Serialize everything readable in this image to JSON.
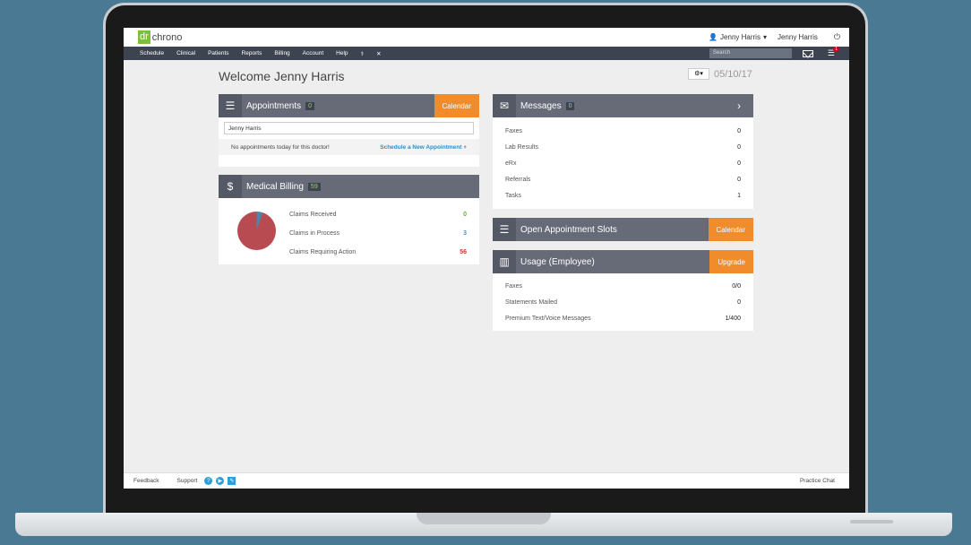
{
  "app": {
    "logo_dr": "dr",
    "logo_name": "chrono"
  },
  "topbar": {
    "user_menu": "Jenny Harris",
    "user_name": "Jenny Harris",
    "power_icon": "power-icon"
  },
  "nav": {
    "items": [
      "Schedule",
      "Clinical",
      "Patients",
      "Reports",
      "Billing",
      "Account",
      "Help"
    ],
    "search_placeholder": "Search",
    "notification_count": "1"
  },
  "page": {
    "welcome": "Welcome Jenny Harris",
    "date": "05/10/17",
    "gear_label": "⚙▾"
  },
  "appointments": {
    "title": "Appointments",
    "count": "0",
    "button": "Calendar",
    "doctor": "Jenny Harris",
    "empty_text": "No appointments today for this doctor!",
    "schedule_link": "Schedule a New Appointment +"
  },
  "billing": {
    "title": "Medical Billing",
    "count": "59",
    "claims": [
      {
        "label": "Claims Received",
        "value": "0"
      },
      {
        "label": "Claims in Process",
        "value": "3"
      },
      {
        "label": "Claims Requiring Action",
        "value": "56"
      }
    ]
  },
  "messages": {
    "title": "Messages",
    "count": "0",
    "rows": [
      {
        "label": "Faxes",
        "value": "0"
      },
      {
        "label": "Lab Results",
        "value": "0"
      },
      {
        "label": "eRx",
        "value": "0"
      },
      {
        "label": "Referrals",
        "value": "0"
      },
      {
        "label": "Tasks",
        "value": "1"
      }
    ]
  },
  "open_slots": {
    "title": "Open Appointment Slots",
    "button": "Calendar"
  },
  "usage": {
    "title": "Usage (Employee)",
    "button": "Upgrade",
    "rows": [
      {
        "label": "Faxes",
        "value": "0/0"
      },
      {
        "label": "Statements Mailed",
        "value": "0"
      },
      {
        "label": "Premium Text/Voice Messages",
        "value": "1/400"
      }
    ]
  },
  "footer": {
    "feedback": "Feedback",
    "support": "Support",
    "chat": "Practice Chat"
  },
  "colors": {
    "accent": "#f08c2b",
    "header": "#676b78",
    "nav": "#3d4450",
    "logo": "#7bbf3e"
  }
}
